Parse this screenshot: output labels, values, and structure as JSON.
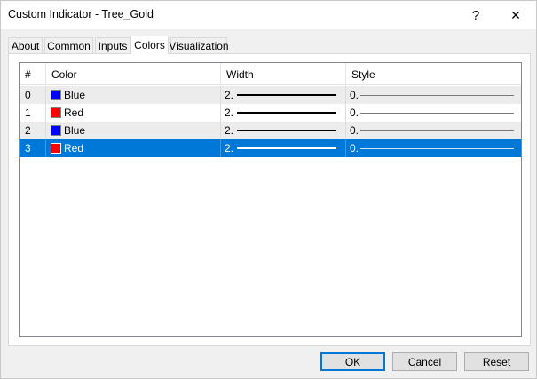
{
  "window": {
    "title": "Custom Indicator - Tree_Gold"
  },
  "titlebar": {
    "help_label": "?",
    "close_label": "✕"
  },
  "tabs": [
    {
      "label": "About",
      "active": false
    },
    {
      "label": "Common",
      "active": false
    },
    {
      "label": "Inputs",
      "active": false
    },
    {
      "label": "Colors",
      "active": true
    },
    {
      "label": "Visualization",
      "active": false
    }
  ],
  "table": {
    "headers": {
      "index": "#",
      "color": "Color",
      "width": "Width",
      "style": "Style"
    },
    "rows": [
      {
        "index": "0",
        "color_name": "Blue",
        "color_hex": "#0000ff",
        "width": "2.",
        "style": "0."
      },
      {
        "index": "1",
        "color_name": "Red",
        "color_hex": "#ff0000",
        "width": "2.",
        "style": "0."
      },
      {
        "index": "2",
        "color_name": "Blue",
        "color_hex": "#0000ff",
        "width": "2.",
        "style": "0."
      },
      {
        "index": "3",
        "color_name": "Red",
        "color_hex": "#ff0000",
        "width": "2.",
        "style": "0."
      }
    ],
    "selected_row": 3
  },
  "buttons": {
    "ok": "OK",
    "cancel": "Cancel",
    "reset": "Reset"
  },
  "colors": {
    "selection": "#0078d7",
    "accent_border": "#0078d7"
  }
}
